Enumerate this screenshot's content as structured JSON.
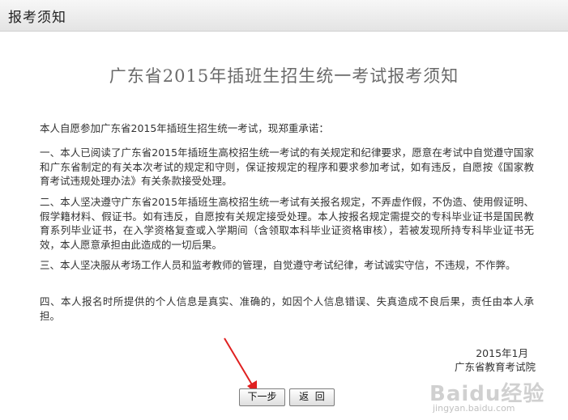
{
  "header": {
    "title": "报考须知"
  },
  "document": {
    "title": "广东省2015年插班生招生统一考试报考须知",
    "intro": "本人自愿参加广东省2015年插班生招生统一考试，现郑重承诺：",
    "items": [
      "一、本人已阅读了广东省2015年插班生高校招生统一考试的有关规定和纪律要求，愿意在考试中自觉遵守国家和广东省制定的有关本次考试的规定和守则，保证按规定的程序和要求参加考试，如有违反，自愿按《国家教育考试违规处理办法》有关条款接受处理。",
      "二、本人坚决遵守广东省2015年插班生高校招生统一考试有关报名规定，不弄虚作假，不伪造、使用假证明、假学籍材料、假证书。如有违反，自愿按有关规定接受处理。本人按报名规定需提交的专科毕业证书是国民教育系列毕业证书，在入学资格复查或入学期间（含领取本科毕业证资格审核），若被发现所持专科毕业证书无效，本人愿意承担由此造成的一切后果。",
      "三、本人坚决服从考场工作人员和监考教师的管理，自觉遵守考试纪律，考试诚实守信，不违规，不作弊。",
      "四、本人报名时所提供的个人信息是真实、准确的，如因个人信息错误、失真造成不良后果，责任由本人承担。"
    ],
    "date": "2015年1月",
    "issuer": "广东省教育考试院"
  },
  "buttons": {
    "next": "下一步",
    "back": "返  回"
  },
  "watermark": {
    "logo": "Baidu经验",
    "url": "jingyan.baidu.com"
  },
  "colors": {
    "arrow": "#e02020",
    "header_bg": "#ececec",
    "title_text": "#6a6a6a"
  }
}
